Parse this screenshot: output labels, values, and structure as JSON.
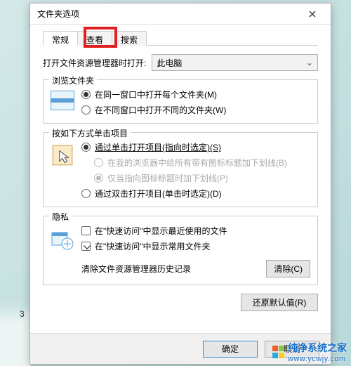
{
  "dialog": {
    "title": "文件夹选项"
  },
  "tabs": {
    "general": "常规",
    "view": "查看",
    "search": "搜索"
  },
  "explorer": {
    "label": "打开文件资源管理器时打开:",
    "value": "此电脑"
  },
  "browse": {
    "title": "浏览文件夹",
    "same_window": "在同一窗口中打开每个文件夹(M)",
    "new_window": "在不同窗口中打开不同的文件夹(W)"
  },
  "click": {
    "title": "按如下方式单击项目",
    "single_click": "通过单击打开项目(指向时选定)(S)",
    "underline_all": "在我的浏览器中给所有带有图标标题加下划线(B)",
    "underline_point": "仅当指向图标标题时加下划线(P)",
    "double_click": "通过双击打开项目(单击时选定)(D)"
  },
  "privacy": {
    "title": "隐私",
    "recent_files": "在\"快速访问\"中显示最近使用的文件",
    "frequent_folders": "在\"快速访问\"中显示常用文件夹",
    "clear_label": "清除文件资源管理器历史记录",
    "clear_btn": "清除(C)"
  },
  "footer": {
    "restore": "还原默认值(R)",
    "ok": "确定",
    "cancel": "取消"
  },
  "watermark": {
    "brand": "纯净系统之家",
    "domain": "www.ycwjy.com"
  },
  "side_num": "3",
  "colors": {
    "logo_a": "#f45a2a",
    "logo_b": "#8ac641",
    "logo_c": "#2aa9e0",
    "logo_d": "#ffcd2a"
  }
}
